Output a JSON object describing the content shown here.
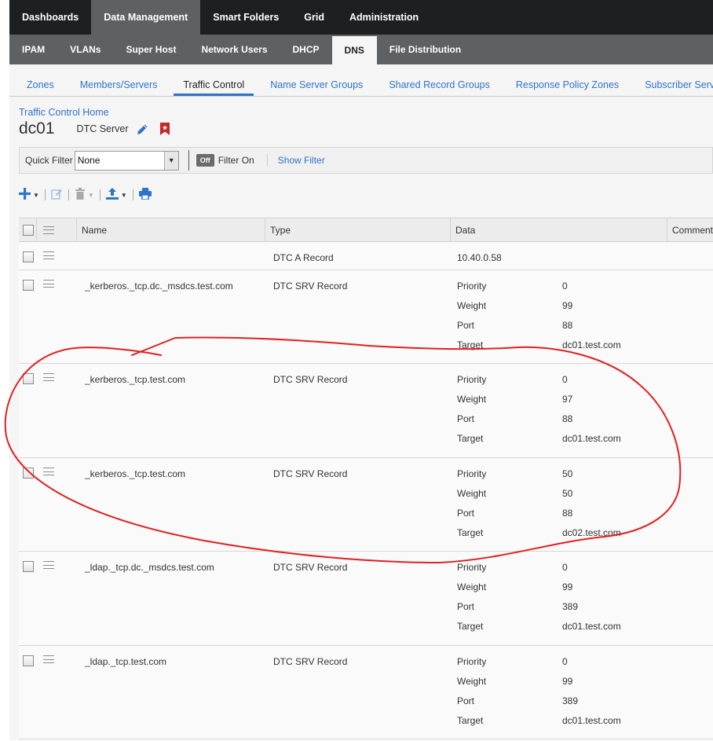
{
  "top_nav": [
    "Dashboards",
    "Data Management",
    "Smart Folders",
    "Grid",
    "Administration"
  ],
  "sub_nav": [
    "IPAM",
    "VLANs",
    "Super Host",
    "Network Users",
    "DHCP",
    "DNS",
    "File Distribution"
  ],
  "tabs": [
    "Zones",
    "Members/Servers",
    "Traffic Control",
    "Name Server Groups",
    "Shared Record Groups",
    "Response Policy Zones",
    "Subscriber Services"
  ],
  "breadcrumb": "Traffic Control Home",
  "page": {
    "title": "dc01",
    "subtitle": "DTC Server",
    "icons": [
      "pencil-icon",
      "bookmark-icon"
    ]
  },
  "filter": {
    "label": "Quick Filter",
    "value": "None",
    "toggle": "Off",
    "toggle_label": "Filter On",
    "show_filter": "Show Filter"
  },
  "toolbar_icons": [
    "add-icon",
    "edit-icon",
    "delete-icon",
    "export-icon",
    "print-icon"
  ],
  "columns": {
    "name": "Name",
    "type": "Type",
    "data": "Data",
    "comment": "Comment"
  },
  "kv_labels": {
    "priority": "Priority",
    "weight": "Weight",
    "port": "Port",
    "target": "Target"
  },
  "rows": [
    {
      "name": "",
      "type": "DTC A Record",
      "address": "10.40.0.58"
    },
    {
      "name": "_kerberos._tcp.dc._msdcs.test.com",
      "type": "DTC SRV Record",
      "priority": "0",
      "weight": "99",
      "port": "88",
      "target": "dc01.test.com"
    },
    {
      "name": "_kerberos._tcp.test.com",
      "type": "DTC SRV Record",
      "priority": "0",
      "weight": "97",
      "port": "88",
      "target": "dc01.test.com"
    },
    {
      "name": "_kerberos._tcp.test.com",
      "type": "DTC SRV Record",
      "priority": "50",
      "weight": "50",
      "port": "88",
      "target": "dc02.test.com"
    },
    {
      "name": "_ldap._tcp.dc._msdcs.test.com",
      "type": "DTC SRV Record",
      "priority": "0",
      "weight": "99",
      "port": "389",
      "target": "dc01.test.com"
    },
    {
      "name": "_ldap._tcp.test.com",
      "type": "DTC SRV Record",
      "priority": "0",
      "weight": "99",
      "port": "389",
      "target": "dc01.test.com"
    }
  ],
  "colors": {
    "link": "#2f74c8",
    "annotation": "#e02020",
    "bookmark": "#c0292e"
  }
}
